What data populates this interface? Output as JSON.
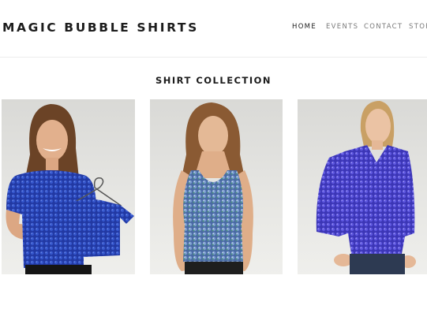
{
  "header": {
    "brand": "MAGIC BUBBLE SHIRTS",
    "nav": [
      {
        "label": "HOME",
        "active": true
      },
      {
        "label": "EVENTS",
        "active": false
      },
      {
        "label": "CONTACT",
        "active": false
      },
      {
        "label": "STOR",
        "active": false
      }
    ]
  },
  "main": {
    "section_title": "SHIRT COLLECTION",
    "products": [
      {
        "shirt_color": "#2743b0",
        "description": "royal blue top with matching child shirt on hanger"
      },
      {
        "shirt_color": "#5b7fb5",
        "description": "blue and green tank top"
      },
      {
        "shirt_color": "#4a43cf",
        "description": "violet collared long-sleeve top"
      }
    ]
  },
  "colors": {
    "text": "#1c1c1c",
    "nav_inactive": "#7a7a7a",
    "tile_bg": "#dcdcd9"
  }
}
